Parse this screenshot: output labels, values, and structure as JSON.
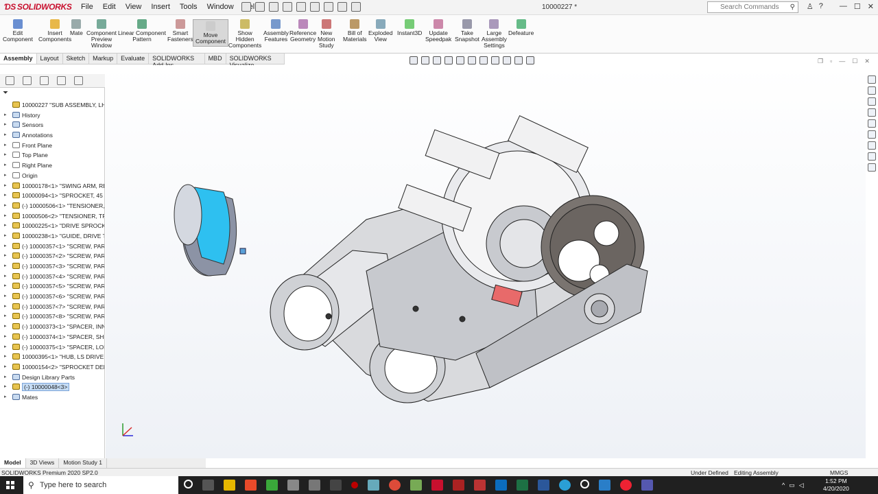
{
  "app": {
    "logo": "SOLIDWORKS",
    "doc_title": "10000227 *"
  },
  "menu": [
    "File",
    "Edit",
    "View",
    "Insert",
    "Tools",
    "Window",
    "Help"
  ],
  "search": {
    "placeholder": "Search Commands"
  },
  "commands": [
    {
      "label": "Edit\nComponent",
      "icon": "edit-component-icon"
    },
    {
      "label": "Insert\nComponents",
      "icon": "insert-components-icon"
    },
    {
      "label": "Mate",
      "icon": "mate-icon"
    },
    {
      "label": "Component\nPreview\nWindow",
      "icon": "preview-window-icon"
    },
    {
      "label": "Linear Component\nPattern",
      "icon": "linear-pattern-icon"
    },
    {
      "label": "Smart\nFasteners",
      "icon": "smart-fasteners-icon"
    },
    {
      "label": "Move\nComponent",
      "icon": "move-component-icon"
    },
    {
      "label": "Show\nHidden\nComponents",
      "icon": "show-hidden-icon"
    },
    {
      "label": "Assembly\nFeatures",
      "icon": "assembly-features-icon"
    },
    {
      "label": "Reference\nGeometry",
      "icon": "reference-geometry-icon"
    },
    {
      "label": "New\nMotion\nStudy",
      "icon": "motion-study-icon"
    },
    {
      "label": "Bill of\nMaterials",
      "icon": "bom-icon"
    },
    {
      "label": "Exploded\nView",
      "icon": "exploded-view-icon"
    },
    {
      "label": "Instant3D",
      "icon": "instant3d-icon"
    },
    {
      "label": "Update\nSpeedpak",
      "icon": "speedpak-icon"
    },
    {
      "label": "Take\nSnapshot",
      "icon": "snapshot-icon"
    },
    {
      "label": "Large\nAssembly\nSettings",
      "icon": "large-assembly-icon"
    },
    {
      "label": "Defeature",
      "icon": "defeature-icon"
    }
  ],
  "tabs": [
    "Assembly",
    "Layout",
    "Sketch",
    "Markup",
    "Evaluate",
    "SOLIDWORKS Add-Ins",
    "MBD",
    "SOLIDWORKS Visualize"
  ],
  "tree": [
    {
      "label": "10000227 \"SUB ASSEMBLY, LH REAR S",
      "icon": "assembly"
    },
    {
      "label": "History",
      "icon": "blue"
    },
    {
      "label": "Sensors",
      "icon": "blue"
    },
    {
      "label": "Annotations",
      "icon": "blue"
    },
    {
      "label": "Front Plane",
      "icon": "plane"
    },
    {
      "label": "Top Plane",
      "icon": "plane"
    },
    {
      "label": "Right Plane",
      "icon": "plane"
    },
    {
      "label": "Origin",
      "icon": "plane"
    },
    {
      "label": "10000178<1> \"SWING ARM, REAR",
      "icon": "part"
    },
    {
      "label": "10000094<1> \"SPROCKET, 45 TOO",
      "icon": "part"
    },
    {
      "label": "(-) 10000506<1> \"TENSIONER, TRA",
      "icon": "part"
    },
    {
      "label": "10000506<2> \"TENSIONER, TRACK",
      "icon": "part"
    },
    {
      "label": "10000225<1> \"DRIVE SPROCKET,",
      "icon": "part"
    },
    {
      "label": "10000238<1> \"GUIDE, DRIVE TRAC",
      "icon": "part"
    },
    {
      "label": "(-) 10000357<1> \"SCREW, PARTIC",
      "icon": "part"
    },
    {
      "label": "(-) 10000357<2> \"SCREW, PARTIC",
      "icon": "part"
    },
    {
      "label": "(-) 10000357<3> \"SCREW, PARTIC",
      "icon": "part"
    },
    {
      "label": "(-) 10000357<4> \"SCREW, PARTIC",
      "icon": "part"
    },
    {
      "label": "(-) 10000357<5> \"SCREW, PARTIC",
      "icon": "part"
    },
    {
      "label": "(-) 10000357<6> \"SCREW, PARTIC",
      "icon": "part"
    },
    {
      "label": "(-) 10000357<7> \"SCREW, PARTIC",
      "icon": "part"
    },
    {
      "label": "(-) 10000357<8> \"SCREW, PARTIC",
      "icon": "part"
    },
    {
      "label": "(-) 10000373<1> \"SPACER, INNER",
      "icon": "part"
    },
    {
      "label": "(-) 10000374<1> \"SPACER, SHORT",
      "icon": "part"
    },
    {
      "label": "(-) 10000375<1> \"SPACER, LONG",
      "icon": "part"
    },
    {
      "label": "10000395<1> \"HUB, LS DRIVE SPR",
      "icon": "part"
    },
    {
      "label": "10000154<2> \"SPROCKET DEBRIS",
      "icon": "part"
    },
    {
      "label": "Design Library Parts",
      "icon": "blue"
    },
    {
      "label": "(-) 10000048<3>",
      "icon": "part",
      "selected": true
    },
    {
      "label": "Mates",
      "icon": "blue"
    }
  ],
  "bottom_tabs": [
    "Model",
    "3D Views",
    "Motion Study 1"
  ],
  "status": {
    "product": "SOLIDWORKS Premium 2020 SP2.0",
    "state": "Under Defined",
    "mode": "Editing Assembly",
    "units": "MMGS"
  },
  "taskbar": {
    "search": "Type here to search",
    "time": "1:52 PM",
    "date": "4/20/2020"
  }
}
